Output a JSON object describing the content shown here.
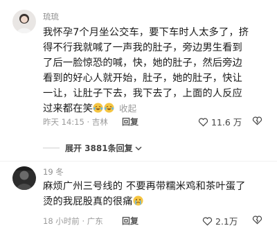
{
  "comments": [
    {
      "username": "琉琉",
      "lines": [
        "我怀孕7个月坐公交车，要下车时人太多了，挤",
        "得不行我就喊了一声我的肚子，旁边男生看到",
        "了后一脸惊恐的喊，快，她的肚子，然后旁边",
        "看到的好心人就开始，肚子，她的肚子，快让",
        "一让，让肚子下去，我下去了，上面的人反应",
        "过来都在笑"
      ],
      "emojis": [
        "laugh-cry-emoji",
        "laugh-cry-emoji"
      ],
      "collapse_label": "收起",
      "meta": "昨天 14:15 · 吉林",
      "reply_label": "回复",
      "likes": "11.6 万",
      "replies_label": "展开 3881条回复"
    },
    {
      "username": "19 冬",
      "lines": [
        "麻烦广州三号线的 不要再带糯米鸡和茶叶蛋了",
        "烫的我屁股真的很痛"
      ],
      "emojis": [
        "crying-emoji"
      ],
      "meta": "18 小时前 · 广东",
      "reply_label": "回复",
      "likes": "2.1万"
    }
  ],
  "colors": {
    "text": "#1a1a1a",
    "meta": "#9a9a9a",
    "emoji": "#f5c542"
  }
}
